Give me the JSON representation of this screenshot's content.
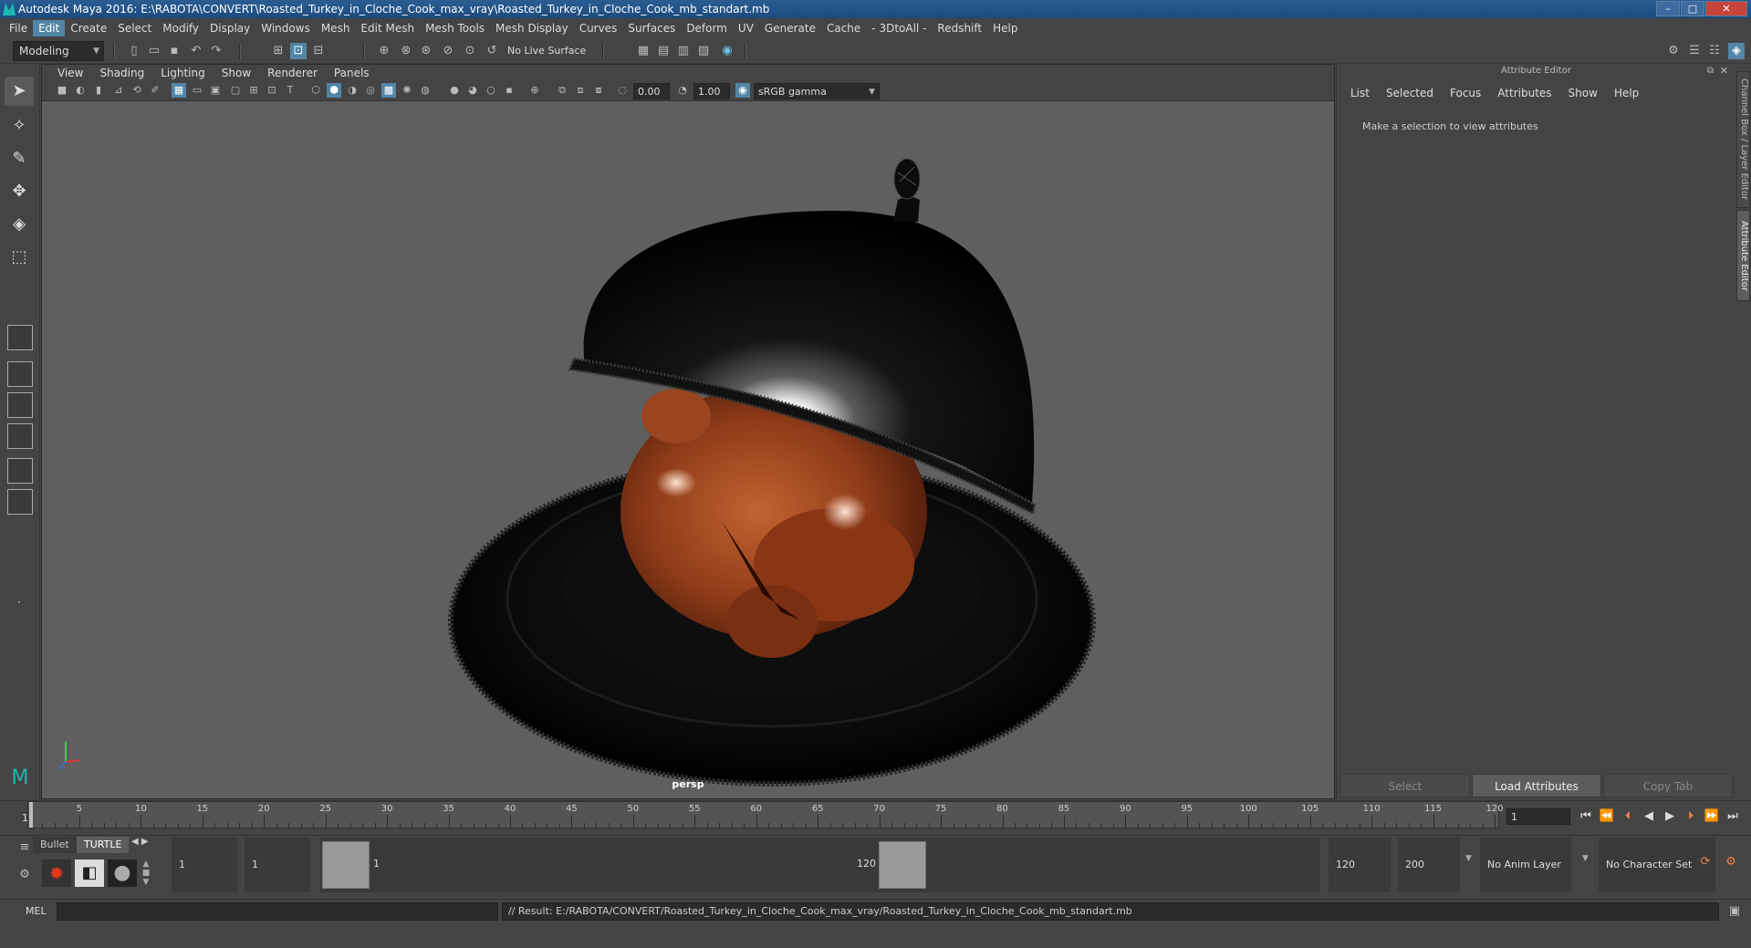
{
  "window": {
    "title": "Autodesk Maya 2016: E:\\RABOTA\\CONVERT\\Roasted_Turkey_in_Cloche_Cook_max_vray\\Roasted_Turkey_in_Cloche_Cook_mb_standart.mb",
    "minimize": "–",
    "maximize": "□",
    "close": "✕"
  },
  "menu": [
    "File",
    "Edit",
    "Create",
    "Select",
    "Modify",
    "Display",
    "Windows",
    "Mesh",
    "Edit Mesh",
    "Mesh Tools",
    "Mesh Display",
    "Curves",
    "Surfaces",
    "Deform",
    "UV",
    "Generate",
    "Cache",
    "- 3DtoAll -",
    "Redshift",
    "Help"
  ],
  "menu_active": "Edit",
  "shelf": {
    "mode": "Modeling",
    "live_surface": "No Live Surface"
  },
  "viewport": {
    "menus": [
      "View",
      "Shading",
      "Lighting",
      "Show",
      "Renderer",
      "Panels"
    ],
    "exposure": "0.00",
    "gamma": "1.00",
    "color_space": "sRGB gamma",
    "camera": "persp"
  },
  "attribute_editor": {
    "title": "Attribute Editor",
    "menus": [
      "List",
      "Selected",
      "Focus",
      "Attributes",
      "Show",
      "Help"
    ],
    "hint": "Make a selection to view attributes",
    "buttons": {
      "select": "Select",
      "load": "Load Attributes",
      "copy": "Copy Tab"
    }
  },
  "side_tabs": {
    "channel_box": "Channel Box / Layer Editor",
    "attr_editor": "Attribute Editor"
  },
  "timeline": {
    "ticks": [
      "5",
      "10",
      "15",
      "20",
      "25",
      "30",
      "35",
      "40",
      "45",
      "50",
      "55",
      "60",
      "65",
      "70",
      "75",
      "80",
      "85",
      "90",
      "95",
      "100",
      "105",
      "110",
      "115",
      "120"
    ],
    "start_label": "1",
    "current_frame": "1"
  },
  "range": {
    "shelf_tabs": [
      "Bullet",
      "TURTLE"
    ],
    "start": "1",
    "playback_start": "1",
    "handle_start": "1",
    "handle_end": "120",
    "playback_end": "120",
    "end": "200",
    "anim_layer": "No Anim Layer",
    "character_set": "No Character Set"
  },
  "command": {
    "mode": "MEL",
    "result": "// Result: E:/RABOTA/CONVERT/Roasted_Turkey_in_Cloche_Cook_max_vray/Roasted_Turkey_in_Cloche_Cook_mb_standart.mb"
  }
}
